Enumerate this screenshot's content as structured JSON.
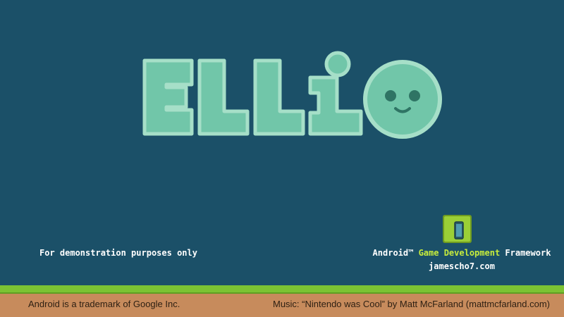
{
  "title": {
    "letters": [
      "E",
      "l",
      "l",
      "i"
    ],
    "logo_colors": {
      "fill": "#71c6a9",
      "outline": "#a6dfc8",
      "shadow": "#2e6b63",
      "face_features": "#2f7464"
    }
  },
  "mascot": {
    "icon": "smiley-face-icon"
  },
  "demo_note": "For demonstration purposes only",
  "framework": {
    "icon": "game-box-icon",
    "prefix": "Android™",
    "accent": "Game Development",
    "suffix": "Framework",
    "site": "jamescho7.com"
  },
  "footer": {
    "left": "Android is a trademark of Google Inc.",
    "right": "Music: “Nintendo was Cool” by Matt McFarland (mattmcfarland.com)"
  },
  "colors": {
    "background": "#1b5068",
    "accent": "#c7ec3c",
    "grass": "#7bc333",
    "ground": "#c78b5c"
  }
}
